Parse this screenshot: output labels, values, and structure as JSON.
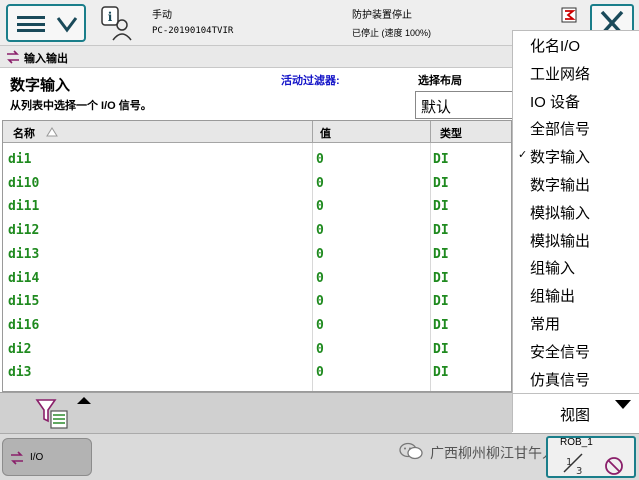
{
  "topbar": {
    "mode": "手动",
    "controller": "PC-20190104TVIR",
    "safety": "防护装置停止",
    "run_state": "已停止 (速度 100%)"
  },
  "app": {
    "title": "输入输出"
  },
  "header": {
    "view_title": "数字输入",
    "instruction": "从列表中选择一个 I/O 信号。",
    "filter_label": "活动过滤器:",
    "layout_label": "选择布局",
    "layout_value": "默认"
  },
  "table": {
    "columns": [
      "名称",
      "值",
      "类型"
    ],
    "rows": [
      {
        "name": "di1",
        "value": "0",
        "type": "DI"
      },
      {
        "name": "di10",
        "value": "0",
        "type": "DI"
      },
      {
        "name": "di11",
        "value": "0",
        "type": "DI"
      },
      {
        "name": "di12",
        "value": "0",
        "type": "DI"
      },
      {
        "name": "di13",
        "value": "0",
        "type": "DI"
      },
      {
        "name": "di14",
        "value": "0",
        "type": "DI"
      },
      {
        "name": "di15",
        "value": "0",
        "type": "DI"
      },
      {
        "name": "di16",
        "value": "0",
        "type": "DI"
      },
      {
        "name": "di2",
        "value": "0",
        "type": "DI"
      },
      {
        "name": "di3",
        "value": "0",
        "type": "DI"
      }
    ]
  },
  "dropdown": {
    "items": [
      {
        "label": "化名I/O",
        "checked": false
      },
      {
        "label": "工业网络",
        "checked": false
      },
      {
        "label": "IO 设备",
        "checked": false
      },
      {
        "label": "全部信号",
        "checked": false
      },
      {
        "label": "数字输入",
        "checked": true
      },
      {
        "label": "数字输出",
        "checked": false
      },
      {
        "label": "模拟输入",
        "checked": false
      },
      {
        "label": "模拟输出",
        "checked": false
      },
      {
        "label": "组输入",
        "checked": false
      },
      {
        "label": "组输出",
        "checked": false
      },
      {
        "label": "常用",
        "checked": false
      },
      {
        "label": "安全信号",
        "checked": false
      },
      {
        "label": "仿真信号",
        "checked": false
      }
    ],
    "view_label": "视图"
  },
  "taskbar": {
    "io_label": "I/O",
    "watermark": "广西柳州柳江甘午人类公众号",
    "speed_label": "ROB_1"
  },
  "colors": {
    "accent": "#1a7e8a",
    "signal_text": "#1f8a1f",
    "filter_label": "#1414c8"
  }
}
